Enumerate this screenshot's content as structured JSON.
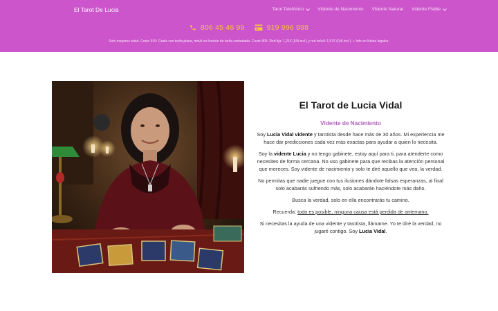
{
  "colors": {
    "header_bg": "#cc55cc",
    "phone_accent": "#f6c243",
    "subtitle": "#b15fbe"
  },
  "header": {
    "brand": "El Tarot De Lucia",
    "nav": [
      {
        "label": "Tarot Telefónico",
        "has_dropdown": true
      },
      {
        "label": "Vidente de Nacimiento",
        "has_dropdown": false
      },
      {
        "label": "Vidente Natural",
        "has_dropdown": false
      },
      {
        "label": "Vidente Fiable",
        "has_dropdown": true
      }
    ],
    "phones": [
      {
        "icon": "phone-icon",
        "number": "806 45 46 99"
      },
      {
        "icon": "credit-card-icon",
        "number": "919 996 998"
      }
    ],
    "disclaimer": "Solo mayores edad. Coste 919: Gratis con tarifa plana, móvil en función de tarifa contratada. Coste 806: Red fija: 1,21€ (IVA incl.) y red móvil: 1,57€ (IVA incl.). + Info en Notas legales."
  },
  "hero": {
    "image_icon": "tarot-reader-photo",
    "title": "El Tarot de Lucia Vidal",
    "subtitle": "Vidente de Nacimiento",
    "p1": {
      "a": "Soy ",
      "b": "Lucia Vidal vidente",
      "c": " y tarotista desde hace más de 30 años. Mi experiencia me hace dar predicciones cada vez más exactas para ayudar a quien lo necesita."
    },
    "p2": {
      "a": "Soy la ",
      "b": "vidente Lucia",
      "c": " y no tengo gabinete, estoy aquí para ti, para atenderte como necesites de forma cercana. No uso gabinete para que recibas la atención personal que mereces. Soy vidente de nacimiento y solo te diré aquello que vea, la verdad."
    },
    "p3": "No permitas que nadie juegue con tus ilusiones dándote falsas esperanzas, al final solo acabarás sufriendo más, solo acabarán haciéndote más daño.",
    "p4": "Busca la verdad, solo en ella encontrarás tu camino.",
    "p5": {
      "a": "Recuerda: ",
      "b": "todo es posible, ninguna causa está perdida de antemano."
    },
    "p6": {
      "a": "Si necesitas la ayuda de una vidente y tarotista, llámame. Yo te diré la verdad, no jugaré contigo. Soy ",
      "b": "Lucia Vidal",
      "c": "."
    }
  }
}
